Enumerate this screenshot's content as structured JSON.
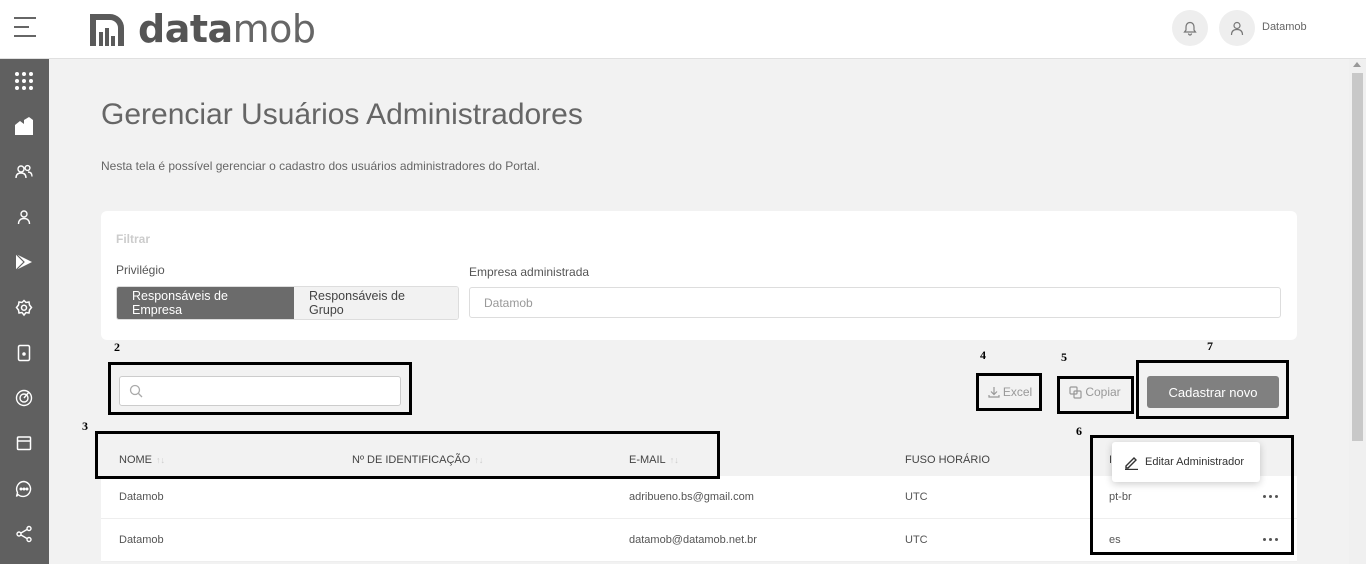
{
  "brand": {
    "logo_bold": "data",
    "logo_light": "mob"
  },
  "header": {
    "username": "Datamob"
  },
  "sidebar": {
    "items": [
      {
        "icon": "apps-grid-icon"
      },
      {
        "icon": "buildings-icon"
      },
      {
        "icon": "users-icon"
      },
      {
        "icon": "user-icon"
      },
      {
        "icon": "play-icon"
      },
      {
        "icon": "settings-icon"
      },
      {
        "icon": "tablet-icon"
      },
      {
        "icon": "target-icon"
      },
      {
        "icon": "calendar-icon"
      },
      {
        "icon": "chat-icon"
      },
      {
        "icon": "share-icon"
      }
    ]
  },
  "page": {
    "title": "Gerenciar Usuários Administradores",
    "description": "Nesta tela é possível gerenciar o cadastro dos usuários administradores do Portal."
  },
  "filter": {
    "title": "Filtrar",
    "privilege_label": "Privilégio",
    "options": [
      "Responsáveis de Empresa",
      "Responsáveis de Grupo"
    ],
    "selected": "Responsáveis de Empresa",
    "company_label": "Empresa administrada",
    "company_placeholder": "Datamob"
  },
  "toolbar": {
    "search_placeholder": "",
    "excel_label": "Excel",
    "copy_label": "Copiar",
    "new_label": "Cadastrar novo"
  },
  "annotations": [
    "2",
    "3",
    "4",
    "5",
    "6",
    "7"
  ],
  "table": {
    "columns": [
      "NOME",
      "Nº DE IDENTIFICAÇÃO",
      "E-MAIL",
      "FUSO HORÁRIO",
      "I"
    ],
    "rows": [
      {
        "name": "Datamob",
        "id": "",
        "email": "adribueno.bs@gmail.com",
        "tz": "UTC",
        "lang": "pt-br"
      },
      {
        "name": "Datamob",
        "id": "",
        "email": "datamob@datamob.net.br",
        "tz": "UTC",
        "lang": "es"
      }
    ]
  },
  "row_menu": {
    "edit_label": "Editar Administrador"
  }
}
